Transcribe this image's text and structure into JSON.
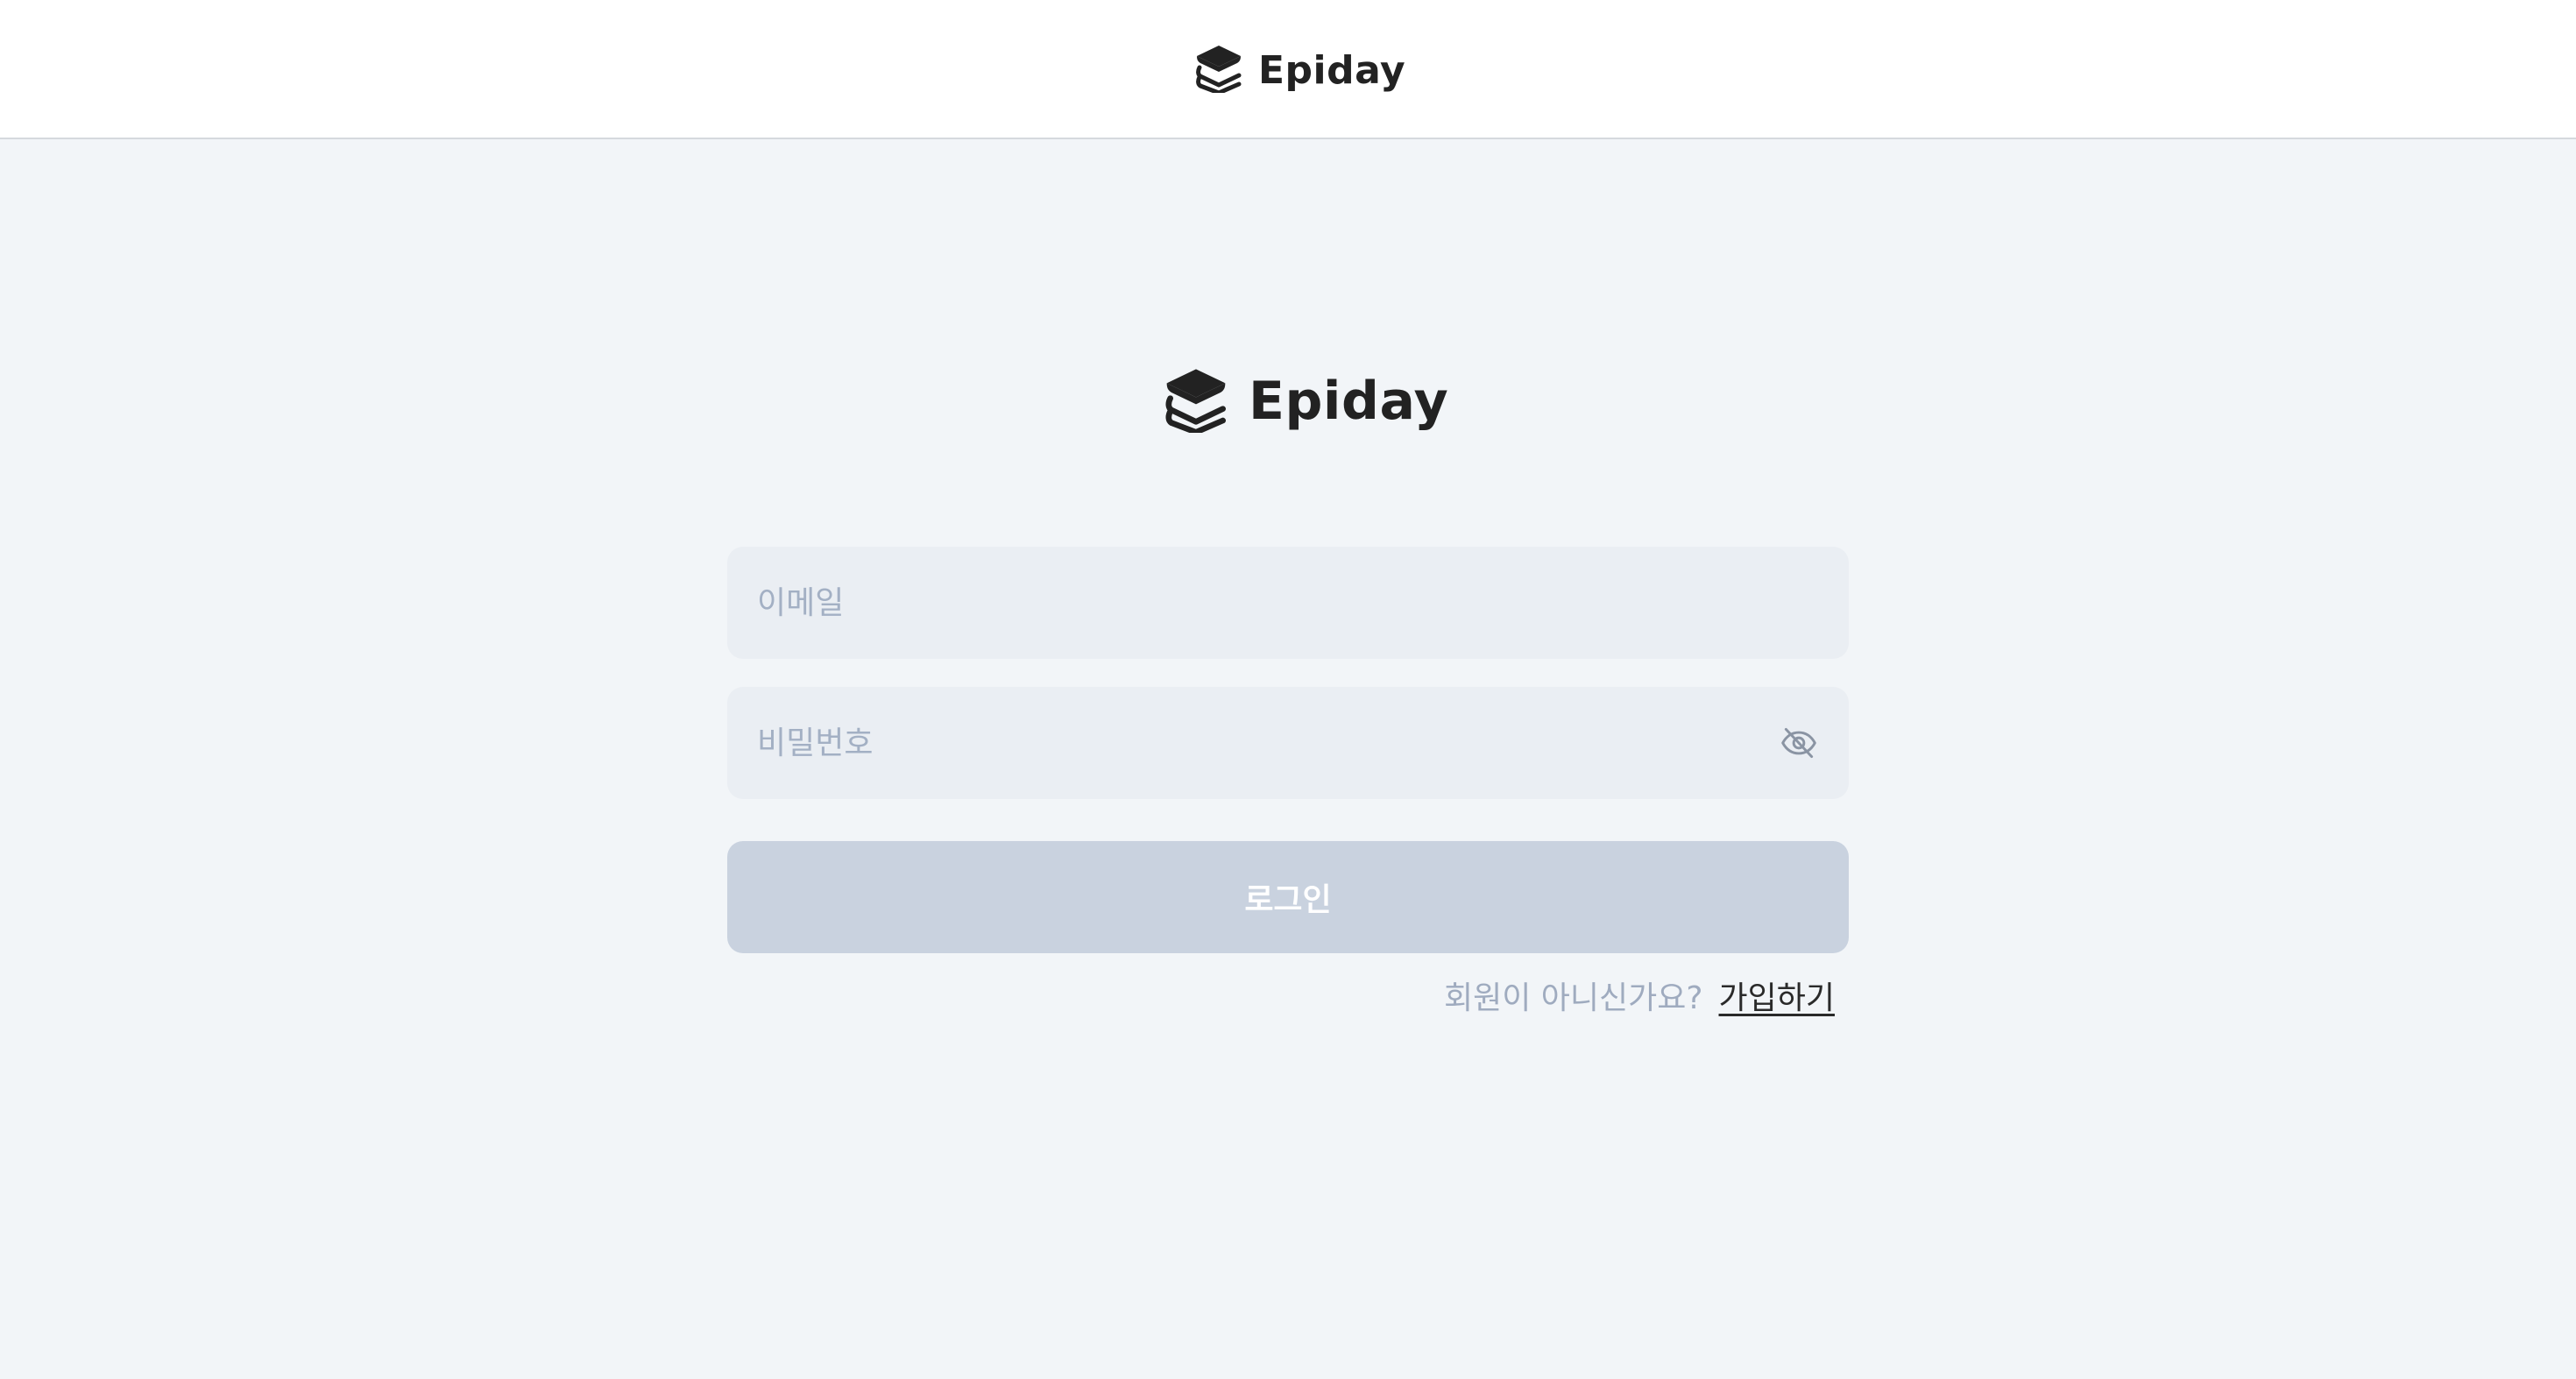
{
  "header": {
    "brand_name": "Epiday",
    "logo_icon": "book-stack-icon"
  },
  "main": {
    "brand_name": "Epiday",
    "logo_icon": "book-stack-icon",
    "email": {
      "placeholder": "이메일",
      "value": ""
    },
    "password": {
      "placeholder": "비밀번호",
      "value": "",
      "toggle_icon": "eye-off-icon"
    },
    "login_label": "로그인",
    "signup_question": "회원이 아니신가요?",
    "signup_link": "가입하기"
  },
  "colors": {
    "background": "#f2f5f8",
    "field_background": "#eaeef3",
    "button_disabled": "#c9d2df",
    "placeholder": "#a3b0c4",
    "brand_text": "#222222"
  }
}
